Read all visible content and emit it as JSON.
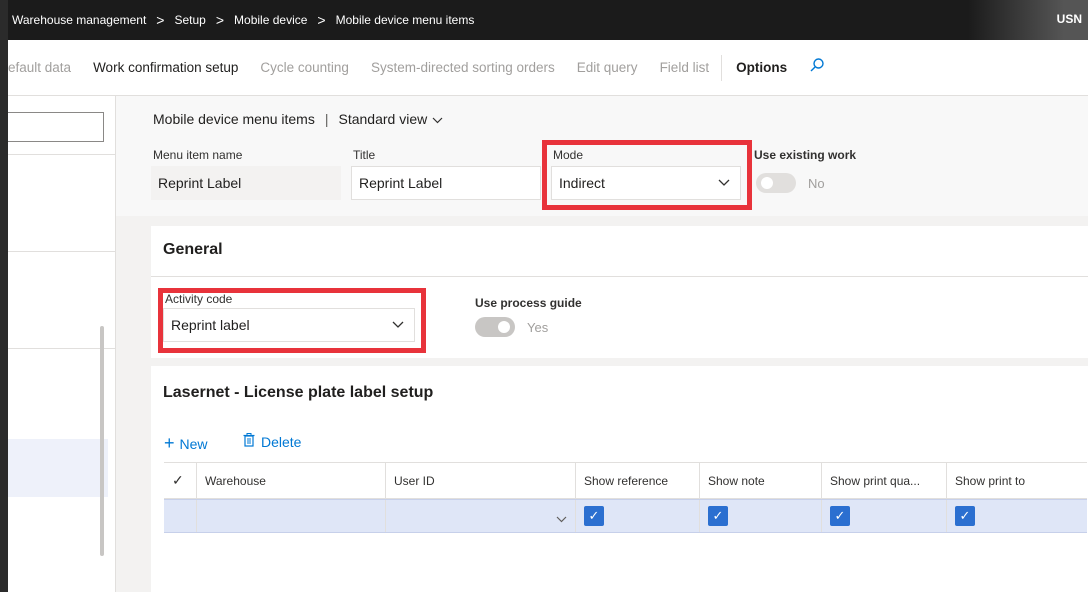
{
  "nav": {
    "crumbs": [
      "Warehouse management",
      "Setup",
      "Mobile device",
      "Mobile device menu items"
    ],
    "separator": ">",
    "user": "USN"
  },
  "actions": {
    "items": [
      "efault data",
      "Work confirmation setup",
      "Cycle counting",
      "System-directed sorting orders",
      "Edit query",
      "Field list"
    ],
    "options_label": "Options",
    "search_icon": "search-icon"
  },
  "header": {
    "page_name": "Mobile device menu items",
    "separator": "|",
    "view_label": "Standard view",
    "fields": {
      "menu_item_name_label": "Menu item name",
      "menu_item_name_value": "Reprint Label",
      "title_label": "Title",
      "title_value": "Reprint Label",
      "mode_label": "Mode",
      "mode_value": "Indirect",
      "use_existing_work_label": "Use existing work",
      "use_existing_work_value": "No"
    }
  },
  "general": {
    "title": "General",
    "activity_code_label": "Activity code",
    "activity_code_value": "Reprint label",
    "use_process_guide_label": "Use process guide",
    "use_process_guide_value": "Yes"
  },
  "lasernet": {
    "title": "Lasernet - License plate label setup",
    "new_label": "New",
    "delete_label": "Delete",
    "columns": [
      "Warehouse",
      "User ID",
      "Show reference",
      "Show note",
      "Show print qua...",
      "Show print to"
    ],
    "row": {
      "warehouse": "",
      "user_id": "",
      "show_reference": true,
      "show_note": true,
      "show_print_qty": true,
      "show_print_to": true
    }
  },
  "colors": {
    "accent": "#0078d4",
    "highlight": "#e8333b",
    "checkbox": "#2b6fd0"
  }
}
